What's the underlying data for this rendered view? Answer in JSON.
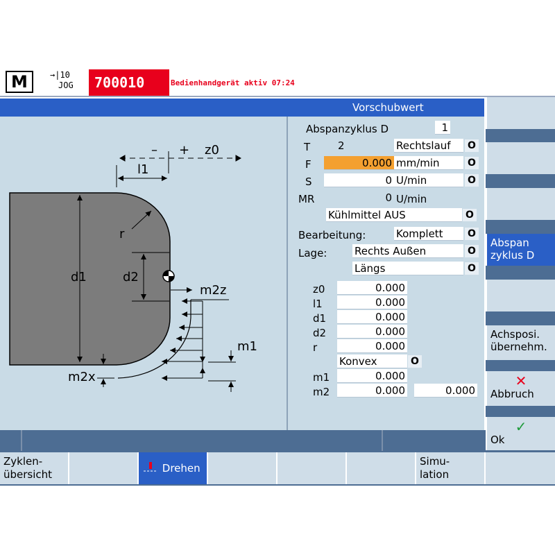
{
  "header": {
    "logo_letter": "M",
    "mode_top": "→|10",
    "mode_bottom": "JOG",
    "program": "700010",
    "message": "Bedienhandgerät aktiv 07:24"
  },
  "title": "Vorschubwert",
  "graphic": {
    "labels": {
      "minus": "–",
      "plus": "+",
      "z0": "z0",
      "l1": "l1",
      "r": "r",
      "d1": "d1",
      "d2": "d2",
      "m2z": "m2z",
      "m1": "m1",
      "m2x": "m2x"
    }
  },
  "form": {
    "cycle_label": "Abspanzyklus D",
    "cycle_value": "1",
    "t_label": "T",
    "t_value": "2",
    "t_dir": "Rechtslauf",
    "f_label": "F",
    "f_value": "0.000",
    "f_unit": "mm/min",
    "s_label": "S",
    "s_value": "0",
    "s_unit": "U/min",
    "mr_label": "MR",
    "mr_value": "0",
    "mr_unit": "U/min",
    "coolant": "Kühlmittel AUS",
    "machining_label": "Bearbeitung:",
    "machining_value": "Komplett",
    "position_label": "Lage:",
    "position_value": "Rechts Außen",
    "direction_value": "Längs",
    "params": [
      {
        "name": "z0",
        "value": "0.000"
      },
      {
        "name": "l1",
        "value": "0.000"
      },
      {
        "name": "d1",
        "value": "0.000"
      },
      {
        "name": "d2",
        "value": "0.000"
      },
      {
        "name": "r",
        "value": "0.000"
      }
    ],
    "shape": "Konvex",
    "m1_label": "m1",
    "m1_value": "0.000",
    "m2_label": "m2",
    "m2_value": "0.000",
    "m2_value2": "0.000",
    "toggle_glyph": "O"
  },
  "vsoftkeys": {
    "abspan": "Abspan\nzyklus D",
    "achsposi": "Achsposi.\nübernehm.",
    "abbruch": "Abbruch",
    "ok": "Ok"
  },
  "hsoftkeys": {
    "zyklen": "Zyklen-\nübersicht",
    "drehen": "Drehen",
    "simulation": "Simu-\nlation"
  },
  "colors": {
    "accent": "#2a5fc6",
    "alarm": "#e8001c",
    "highlight": "#f4a030",
    "panel": "#c9dbe6"
  }
}
